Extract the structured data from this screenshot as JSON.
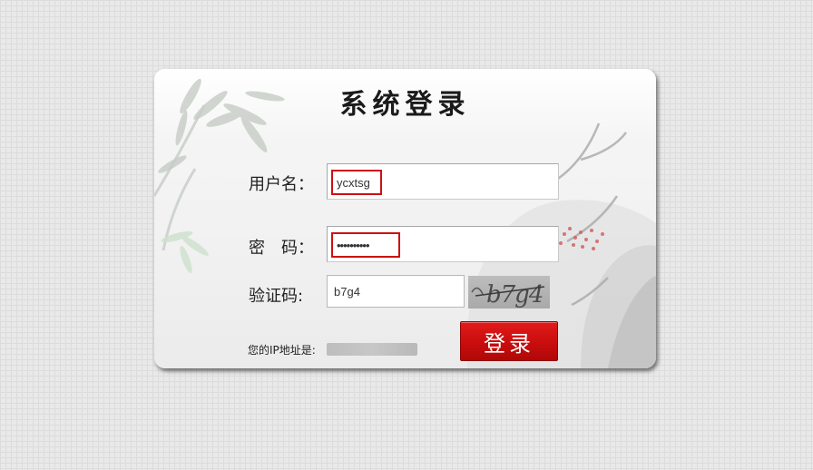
{
  "login": {
    "title": "系统登录",
    "username_label": "用户名：",
    "username_value": "ycxtsg",
    "password_label": "密　码：",
    "password_value": "••••••••••",
    "captcha_label": "验证码:",
    "captcha_value": "b7g4",
    "captcha_image_text": "b7g4",
    "login_button": "登录",
    "ip_label": "您的IP地址是:"
  },
  "colors": {
    "button_red": "#cc1111",
    "highlight_border": "#cc1111"
  },
  "icons": {
    "decoration": "bamboo-plum-ink-painting"
  }
}
